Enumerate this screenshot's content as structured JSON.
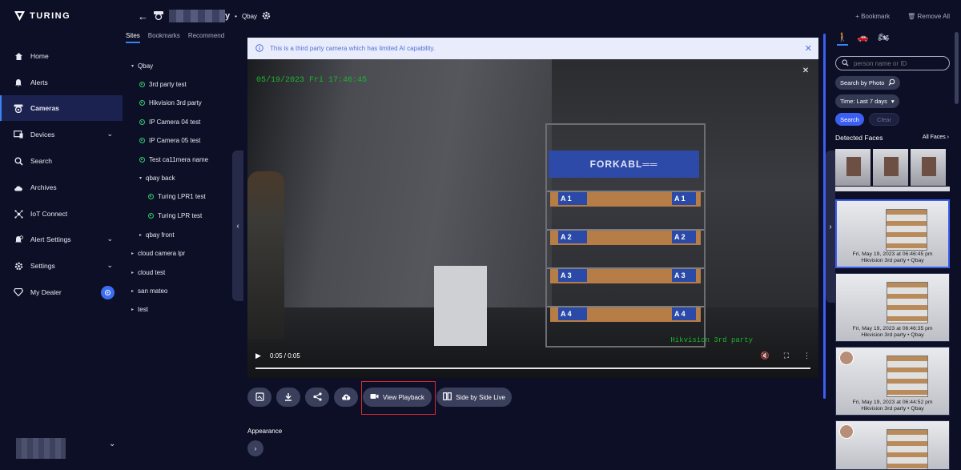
{
  "brand": {
    "name": "TURING"
  },
  "nav": {
    "items": [
      {
        "label": "Home",
        "icon": "home-icon"
      },
      {
        "label": "Alerts",
        "icon": "bell-icon"
      },
      {
        "label": "Cameras",
        "icon": "camera-icon",
        "active": true
      },
      {
        "label": "Devices",
        "icon": "devices-icon"
      },
      {
        "label": "Search",
        "icon": "search-icon"
      },
      {
        "label": "Archives",
        "icon": "cloud-icon"
      },
      {
        "label": "IoT Connect",
        "icon": "iot-icon"
      },
      {
        "label": "Alert Settings",
        "icon": "alert-settings-icon"
      },
      {
        "label": "Settings",
        "icon": "gear-icon"
      },
      {
        "label": "My Dealer",
        "icon": "dealer-icon"
      }
    ]
  },
  "sites": {
    "tabs": [
      "Sites",
      "Bookmarks",
      "Recommend"
    ],
    "tree": [
      {
        "label": "Qbay"
      },
      {
        "label": "3rd party test"
      },
      {
        "label": "Hikvision 3rd party"
      },
      {
        "label": "IP Camera 04 test"
      },
      {
        "label": "IP Camera 05 test"
      },
      {
        "label": "Test ca11mera name"
      },
      {
        "label": "qbay back"
      },
      {
        "label": "Turing LPR1 test"
      },
      {
        "label": "Turing LPR test"
      },
      {
        "label": "qbay front"
      },
      {
        "label": "cloud camera lpr"
      },
      {
        "label": "cloud test"
      },
      {
        "label": "san mateo"
      },
      {
        "label": "test"
      }
    ]
  },
  "header": {
    "camera_suffix": "y",
    "site": "Qbay"
  },
  "top_actions": {
    "bookmark": "Bookmark",
    "remove_all": "Remove All"
  },
  "banner": {
    "text": "This is a third party camera which has limited AI capability."
  },
  "video": {
    "timestamp": "05/19/2023 Fri 17:46:45",
    "watermark": "Hikvision 3rd party",
    "time": "0:05 / 0:05",
    "progress": 1.0,
    "forkable": "FORKABL══"
  },
  "actions": {
    "view_playback": "View Playback",
    "side_by_side": "Side by Side Live"
  },
  "appearance": {
    "label": "Appearance"
  },
  "right_panel": {
    "search_placeholder": "person name or ID",
    "search_by_photo": "Search by Photo",
    "time_filter": "Time: Last 7 days",
    "search_btn": "Search",
    "clear_btn": "Clear",
    "detected_title": "Detected Faces",
    "all_faces": "All Faces",
    "thumbs": [
      {
        "date": "Fri, May 19, 2023 at 06:46:45 pm",
        "camera": "Hikvision 3rd party • Qbay"
      },
      {
        "date": "Fri, May 19, 2023 at 06:46:35 pm",
        "camera": "Hikvision 3rd party • Qbay"
      },
      {
        "date": "Fri, May 19, 2023 at 06:44:52 pm",
        "camera": "Hikvision 3rd party • Qbay"
      }
    ]
  },
  "colors": {
    "accent": "#3b5ff2",
    "highlight": "#d42b2b",
    "online": "#2fcf6b"
  }
}
